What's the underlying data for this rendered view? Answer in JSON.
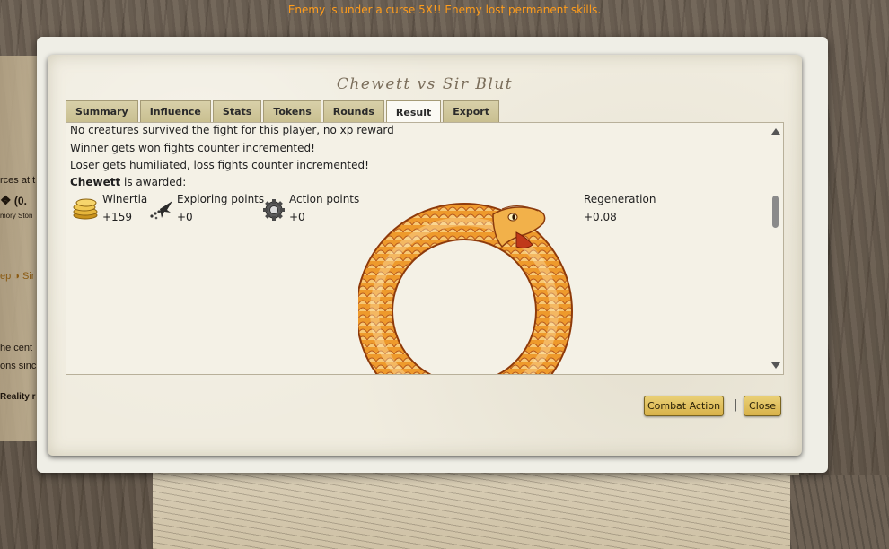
{
  "notice": "Enemy is under a curse 5X!! Enemy lost permanent skills.",
  "background": {
    "frag_sources": "rces at t",
    "frag_value": "(0.",
    "frag_memory": "mory Ston",
    "frag_link": "ep",
    "frag_link2": "Sir",
    "frag_center": "he cent",
    "frag_since": "ons sinc",
    "frag_reality": "Reality r"
  },
  "dialog": {
    "title": "Chewett vs Sir Blut",
    "tabs": [
      {
        "label": "Summary"
      },
      {
        "label": "Influence"
      },
      {
        "label": "Stats"
      },
      {
        "label": "Tokens"
      },
      {
        "label": "Rounds"
      },
      {
        "label": "Result",
        "active": true
      },
      {
        "label": "Export"
      }
    ],
    "result": {
      "line1": "No creatures survived the fight for this player, no xp reward",
      "line2": "Winner gets won fights counter incremented!",
      "line3": "Loser gets humiliated, loss fights counter incremented!",
      "awarded_player": "Chewett",
      "awarded_suffix": " is awarded:",
      "rewards": [
        {
          "label": "Winertia",
          "value": "+159",
          "icon": "coins-icon"
        },
        {
          "label": "Exploring points",
          "value": "+0",
          "icon": "exploring-icon"
        },
        {
          "label": "Action points",
          "value": "+0",
          "icon": "gear-icon"
        },
        {
          "label": "Regeneration",
          "value": "+0.08",
          "icon": "ouroboros-icon"
        }
      ]
    },
    "buttons": {
      "combat_action": "Combat Action",
      "separator": "|",
      "close": "Close"
    }
  },
  "colors": {
    "notice": "#ff9d1c",
    "button_fill": "#d8b24a",
    "snake_orange": "#e8902a"
  }
}
